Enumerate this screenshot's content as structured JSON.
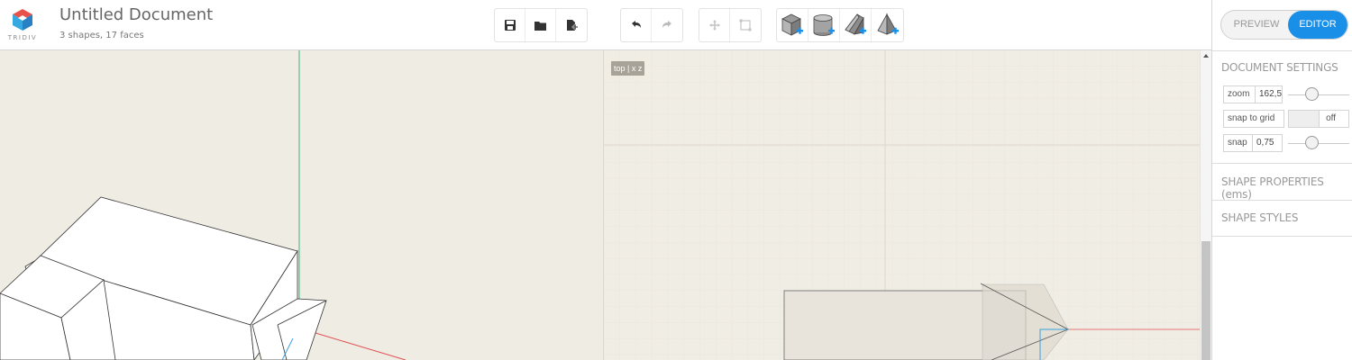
{
  "app": {
    "logo_text": "TRIDIV",
    "document_title": "Untitled Document",
    "document_stats": "3 shapes, 17 faces"
  },
  "toolbar": {
    "file": [
      {
        "name": "save-icon"
      },
      {
        "name": "open-folder-icon"
      },
      {
        "name": "new-file-icon"
      }
    ],
    "history": [
      {
        "name": "undo-icon"
      },
      {
        "name": "redo-icon"
      }
    ],
    "tools": [
      {
        "name": "move-icon"
      },
      {
        "name": "resize-icon"
      }
    ],
    "add_shapes": [
      {
        "name": "add-cube-icon"
      },
      {
        "name": "add-cylinder-icon"
      },
      {
        "name": "add-prism-icon"
      },
      {
        "name": "add-pyramid-icon"
      }
    ]
  },
  "mode": {
    "preview_label": "PREVIEW",
    "editor_label": "EDITOR",
    "active": "editor"
  },
  "document_settings": {
    "title": "DOCUMENT SETTINGS",
    "zoom_label": "zoom",
    "zoom_value": "162,5",
    "snap_to_grid_label": "snap to grid",
    "snap_to_grid_value": "off",
    "snap_label": "snap",
    "snap_value": "0,75"
  },
  "sections": {
    "shape_properties": "SHAPE PROPERTIES (ems)",
    "shape_styles": "SHAPE STYLES"
  },
  "viewport": {
    "view_label": "top | x z"
  },
  "colors": {
    "accent": "#1a8fe8",
    "axis_x": "#e05050",
    "axis_y": "#40b080",
    "axis_z": "#3aa0e0",
    "canvas": "#f0ede5"
  }
}
